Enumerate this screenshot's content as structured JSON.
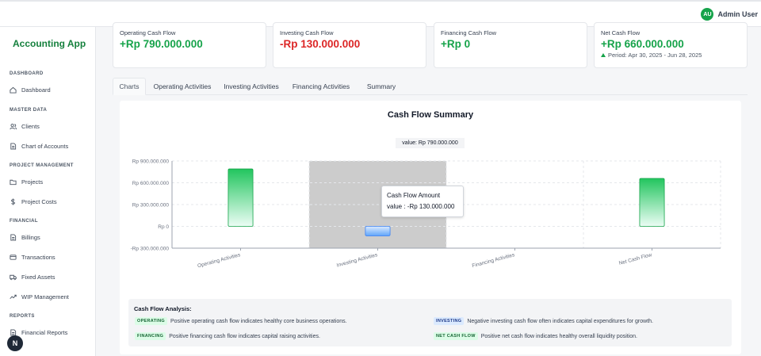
{
  "user": {
    "initials": "AU",
    "name": "Admin User"
  },
  "sidebar": {
    "brand": "Accounting App",
    "sections": [
      {
        "title": "DASHBOARD",
        "items": [
          {
            "label": "Dashboard",
            "icon": "home-icon"
          }
        ]
      },
      {
        "title": "MASTER DATA",
        "items": [
          {
            "label": "Clients",
            "icon": "users-icon"
          },
          {
            "label": "Chart of Accounts",
            "icon": "document-icon"
          }
        ]
      },
      {
        "title": "PROJECT MANAGEMENT",
        "items": [
          {
            "label": "Projects",
            "icon": "folder-icon"
          },
          {
            "label": "Project Costs",
            "icon": "dollar-icon"
          }
        ]
      },
      {
        "title": "FINANCIAL",
        "items": [
          {
            "label": "Billings",
            "icon": "document-icon"
          },
          {
            "label": "Transactions",
            "icon": "card-icon"
          },
          {
            "label": "Fixed Assets",
            "icon": "truck-icon"
          },
          {
            "label": "WIP Management",
            "icon": "chart-line-icon"
          }
        ]
      },
      {
        "title": "REPORTS",
        "items": [
          {
            "label": "Financial Reports",
            "icon": "document-icon"
          }
        ]
      }
    ],
    "fab_label": "N"
  },
  "cards": [
    {
      "label": "Operating Cash Flow",
      "value": "+Rp 790.000.000",
      "tone": "positive"
    },
    {
      "label": "Investing Cash Flow",
      "value": "-Rp 130.000.000",
      "tone": "negative"
    },
    {
      "label": "Financing Cash Flow",
      "value": "+Rp 0",
      "tone": "positive"
    },
    {
      "label": "Net Cash Flow",
      "value": "+Rp 660.000.000",
      "tone": "positive",
      "period": "Period: Apr 30, 2025 - Jun 28, 2025"
    }
  ],
  "tabs": [
    "Charts",
    "Operating Activities",
    "Investing Activities",
    "Financing Activities",
    "Summary"
  ],
  "active_tab": "Charts",
  "chart": {
    "title": "Cash Flow Summary",
    "legend_text": "value: Rp 790.000.000",
    "tooltip": {
      "title": "Cash Flow Amount",
      "line": "value : -Rp 130.000.000"
    }
  },
  "chart_data": {
    "type": "bar",
    "title": "Cash Flow Summary",
    "categories": [
      "Operating Activities",
      "Investing Activities",
      "Financing Activities",
      "Net Cash Flow"
    ],
    "series": [
      {
        "name": "value",
        "values": [
          790000000,
          -130000000,
          0,
          660000000
        ]
      }
    ],
    "ylim": [
      -300000000,
      900000000
    ],
    "ytick_values": [
      900000000,
      600000000,
      300000000,
      0,
      -300000000
    ],
    "yticks": [
      "Rp 900.000.000",
      "Rp 600.000.000",
      "Rp 300.000.000",
      "Rp 0",
      "-Rp 300.000.000"
    ],
    "grid": true,
    "highlighted_category": "Investing Activities",
    "colors": {
      "positive": "#22c55e",
      "negative": "#60a5fa",
      "highlight": "#cccccc"
    }
  },
  "analysis": {
    "title": "Cash Flow Analysis:",
    "items": [
      {
        "badge": "OPERATING",
        "text": "Positive operating cash flow indicates healthy core business operations.",
        "color": "green"
      },
      {
        "badge": "INVESTING",
        "text": "Negative investing cash flow often indicates capital expenditures for growth.",
        "color": "blue"
      },
      {
        "badge": "FINANCING",
        "text": "Positive financing cash flow indicates capital raising activities.",
        "color": "green"
      },
      {
        "badge": "NET CASH FLOW",
        "text": "Positive net cash flow indicates healthy overall liquidity position.",
        "color": "green"
      }
    ]
  }
}
